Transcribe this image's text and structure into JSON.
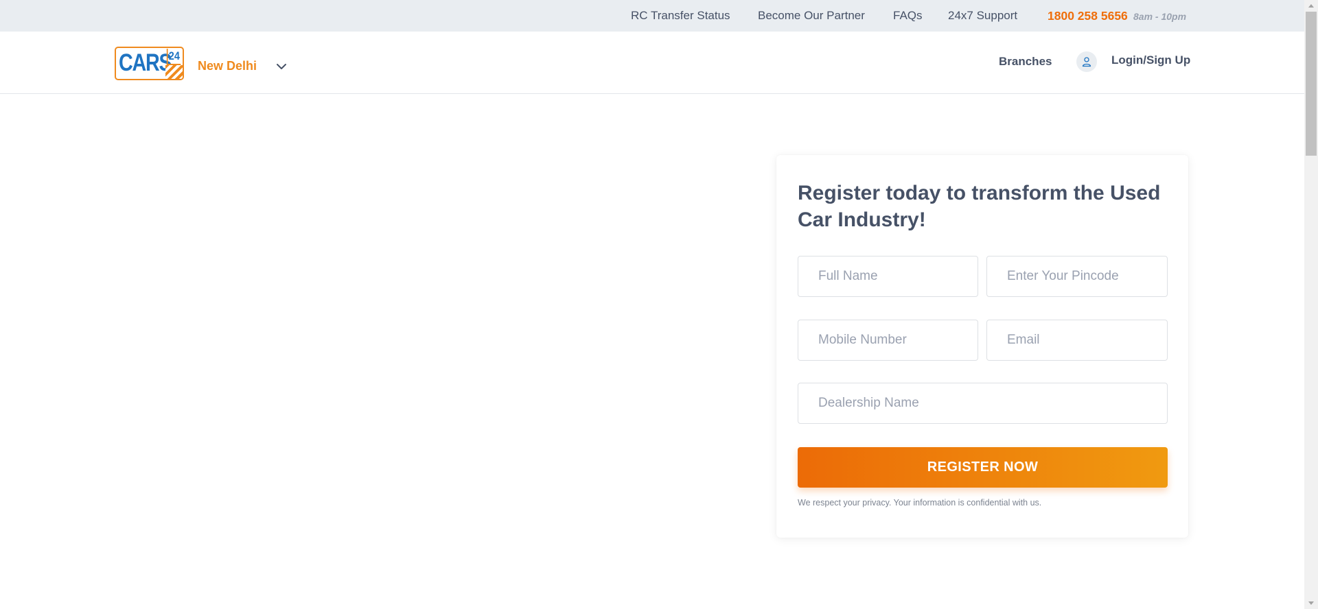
{
  "topbar": {
    "links": [
      "RC Transfer Status",
      "Become Our Partner",
      "FAQs",
      "24x7 Support"
    ],
    "phone": "1800 258 5656",
    "hours": "8am - 10pm"
  },
  "header": {
    "logo_text": "CARS",
    "logo_number": "24",
    "city": "New Delhi",
    "nav": {
      "branches": "Branches",
      "login": "Login/Sign Up"
    }
  },
  "form": {
    "title": "Register today to transform the Used Car Industry!",
    "fields": {
      "full_name": "Full Name",
      "pincode": "Enter Your Pincode",
      "mobile": "Mobile Number",
      "email": "Email",
      "dealership": "Dealership Name"
    },
    "submit_label": "REGISTER NOW",
    "privacy_note": "We respect your privacy. Your information is confidential with us."
  },
  "colors": {
    "accent_orange": "#ef6e0b",
    "logo_blue": "#1f74c2",
    "topbar_bg": "#e9edf1",
    "text": "#465166"
  },
  "icons": {
    "city_dropdown": "chevron-down-icon",
    "user": "user-icon"
  }
}
